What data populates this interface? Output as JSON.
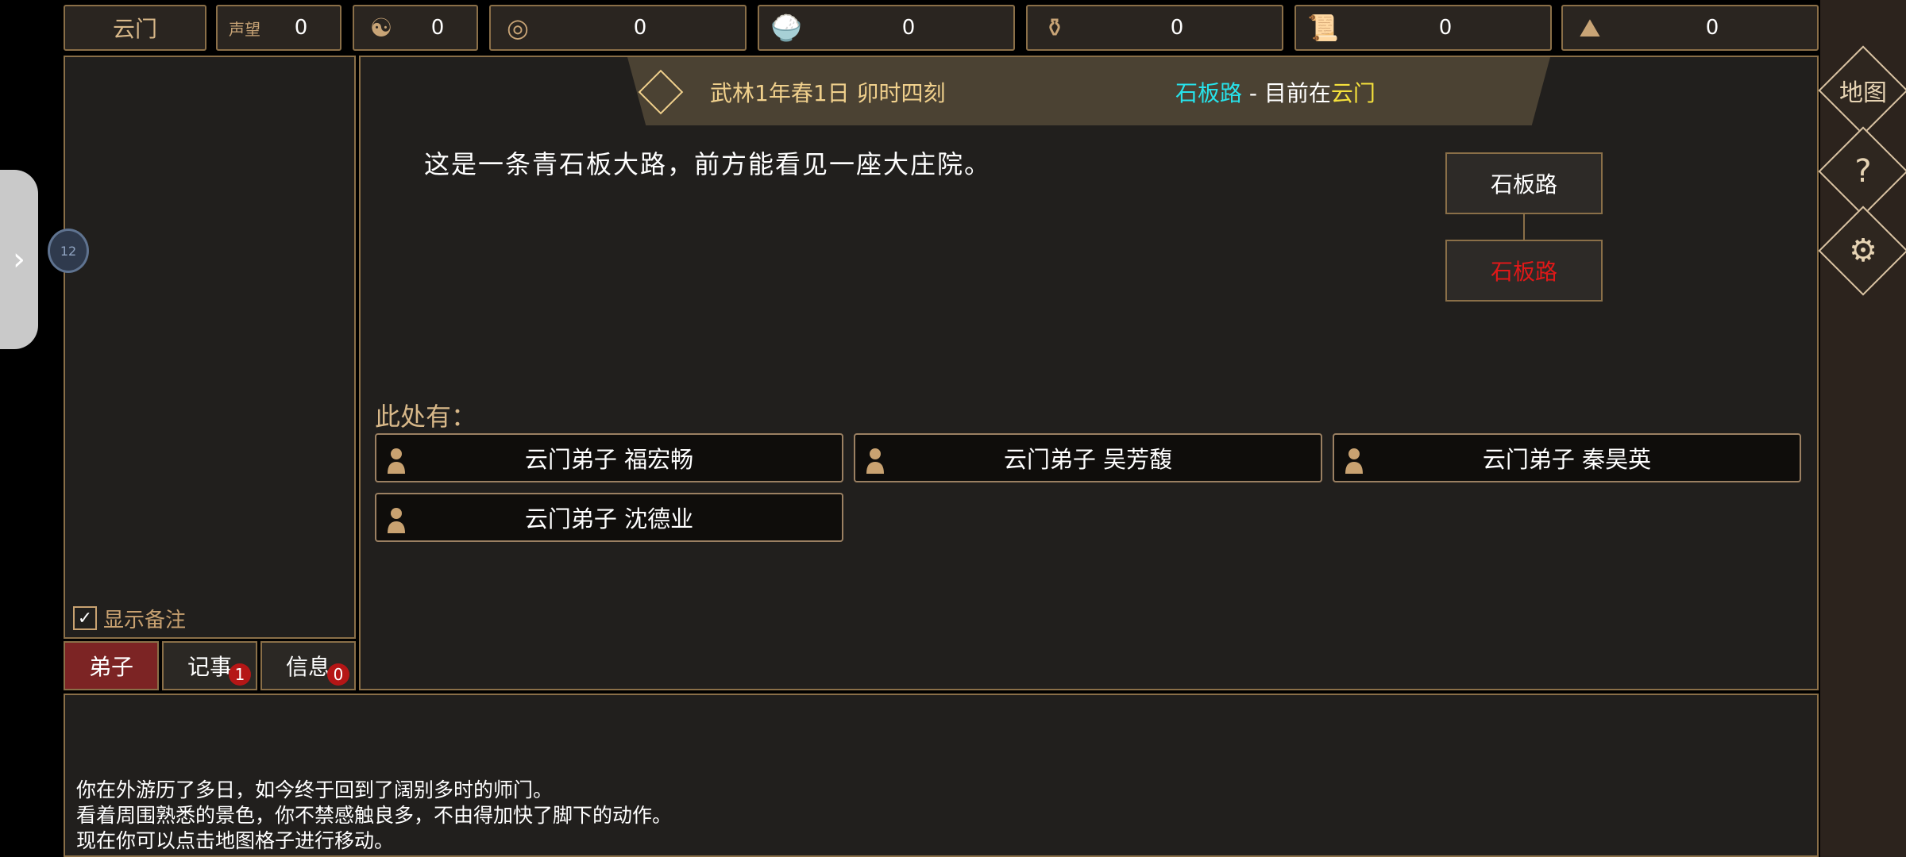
{
  "top_bar": {
    "sect": "云门",
    "resources": [
      {
        "icon": "reputation-icon",
        "glyph": "声望",
        "value": "0"
      },
      {
        "icon": "yin-yang-icon",
        "glyph": "☯",
        "value": "0"
      },
      {
        "icon": "coin-icon",
        "glyph": "◎",
        "value": "0"
      },
      {
        "icon": "food-bowl-icon",
        "glyph": "🍚",
        "value": "0"
      },
      {
        "icon": "gourd-icon",
        "glyph": "⚱",
        "value": "0"
      },
      {
        "icon": "scroll-icon",
        "glyph": "📜",
        "value": "0"
      },
      {
        "icon": "ore-icon",
        "glyph": "⛰",
        "value": "0"
      }
    ]
  },
  "left": {
    "show_memo": "显示备注",
    "tabs": [
      {
        "label": "弟子",
        "badge": ""
      },
      {
        "label": "记事",
        "badge": "1"
      },
      {
        "label": "信息",
        "badge": "0"
      }
    ]
  },
  "banner": {
    "date": "武林1年春1日 卯时四刻",
    "location": "石板路",
    "separator": " - 目前在",
    "current": "云门"
  },
  "scene": {
    "description": "这是一条青石板大路，前方能看见一座大庄院。",
    "map": [
      {
        "label": "石板路",
        "color": "#ffffff"
      },
      {
        "label": "石板路",
        "color": "#e01818"
      }
    ],
    "here_label": "此处有：",
    "npcs": [
      "云门弟子  福宏畅",
      "云门弟子  吴芳馥",
      "云门弟子  秦昊英",
      "云门弟子  沈德业"
    ]
  },
  "log": [
    "你在外游历了多日，如今终于回到了阔别多时的师门。",
    "看着周围熟悉的景色，你不禁感触良多，不由得加快了脚下的动作。",
    "现在你可以点击地图格子进行移动。"
  ],
  "right_menu": {
    "map": "地图",
    "help": "?",
    "settings": "⚙"
  },
  "side": {
    "handle": "›",
    "circle": "12"
  }
}
